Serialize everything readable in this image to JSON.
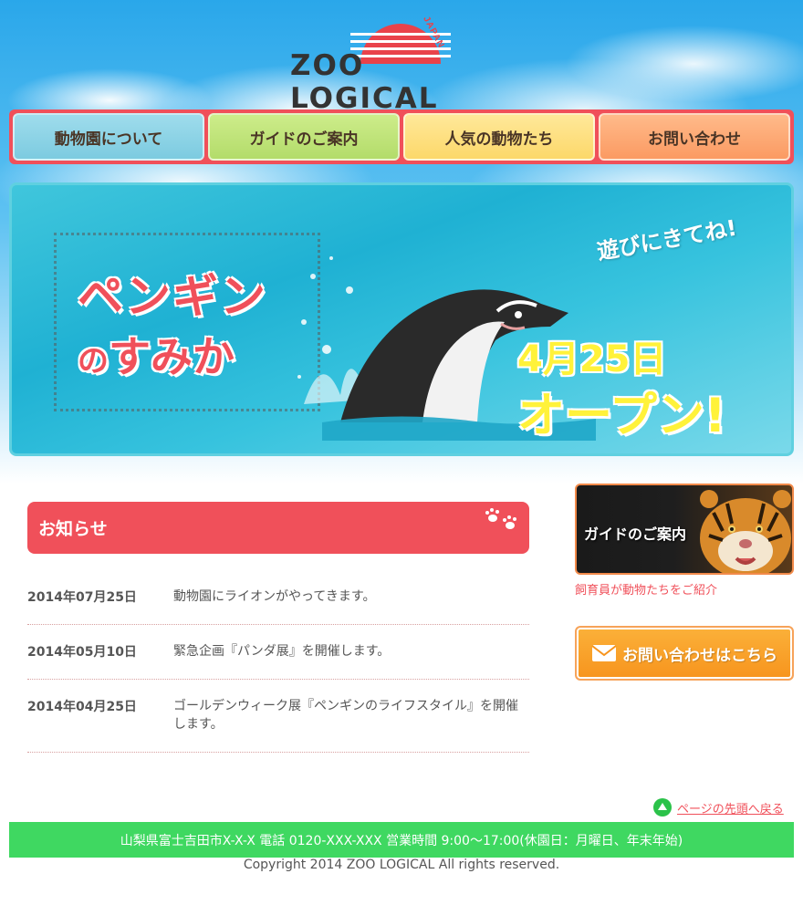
{
  "logo": {
    "name": "ZOO LOGICAL",
    "tag": "JAPAN"
  },
  "nav": {
    "items": [
      {
        "label": "動物園について"
      },
      {
        "label": "ガイドのご案内"
      },
      {
        "label": "人気の動物たち"
      },
      {
        "label": "お問い合わせ"
      }
    ]
  },
  "hero": {
    "title_line1": "ペンギン",
    "title_line2_small": "の",
    "title_line2": "すみか",
    "subtitle": "遊びにきてね!",
    "date": "4月25日",
    "open": "オープン!"
  },
  "news": {
    "heading": "お知らせ",
    "items": [
      {
        "date": "2014年07月25日",
        "text": "動物園にライオンがやってきます。"
      },
      {
        "date": "2014年05月10日",
        "text": "緊急企画『パンダ展』を開催します。"
      },
      {
        "date": "2014年04月25日",
        "text": "ゴールデンウィーク展『ペンギンのライフスタイル』を開催します。"
      }
    ]
  },
  "sidebar": {
    "guide_label": "ガイドのご案内",
    "guide_caption": "飼育員が動物たちをご紹介",
    "contact_label": "お問い合わせはこちら"
  },
  "to_top": {
    "label": "ページの先頭へ戻る"
  },
  "footer": {
    "info": "山梨県富士吉田市X-X-X 電話 0120-XXX-XXX 営業時間 9:00〜17:00(休園日：月曜日、年末年始)",
    "copyright": "Copyright 2014 ZOO LOGICAL All rights reserved."
  },
  "colors": {
    "accent": "#f0505a",
    "footer": "#3fd861",
    "contact": "#f7941d"
  },
  "icons": [
    "sun-logo-icon",
    "paw-icon",
    "penguin-image",
    "tiger-image",
    "mail-icon",
    "arrow-up-icon"
  ]
}
